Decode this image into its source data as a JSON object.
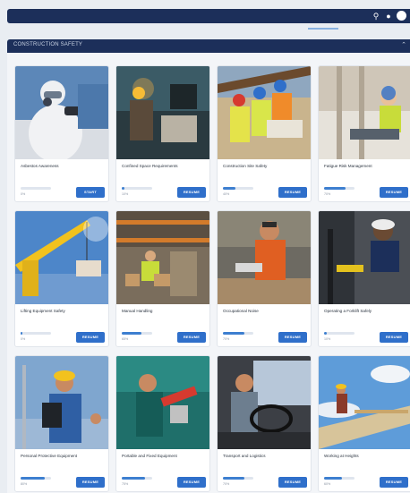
{
  "section": {
    "title": "CONSTRUCTION SAFETY"
  },
  "courses": [
    {
      "title": "Asbestos Awareness",
      "progress_text": "0%",
      "progress": 0,
      "button": "START",
      "scene": "asbestos"
    },
    {
      "title": "Confined Space Requirements",
      "progress_text": "10%",
      "progress": 10,
      "button": "RESUME",
      "scene": "confined"
    },
    {
      "title": "Construction Site Safety",
      "progress_text": "40%",
      "progress": 40,
      "button": "RESUME",
      "scene": "site"
    },
    {
      "title": "Fatigue Risk Management",
      "progress_text": "70%",
      "progress": 70,
      "button": "RESUME",
      "scene": "fatigue"
    },
    {
      "title": "Lifting Equipment Safety",
      "progress_text": "0%",
      "progress": 5,
      "button": "RESUME",
      "scene": "crane"
    },
    {
      "title": "Manual Handling",
      "progress_text": "65%",
      "progress": 65,
      "button": "RESUME",
      "scene": "warehouse"
    },
    {
      "title": "Occupational Noise",
      "progress_text": "70%",
      "progress": 70,
      "button": "RESUME",
      "scene": "noise"
    },
    {
      "title": "Operating a Forklift Safely",
      "progress_text": "10%",
      "progress": 10,
      "button": "RESUME",
      "scene": "forklift"
    },
    {
      "title": "Personal Protective Equipment",
      "progress_text": "80%",
      "progress": 80,
      "button": "RESUME",
      "scene": "ppe"
    },
    {
      "title": "Portable and Fixed Equipment",
      "progress_text": "75%",
      "progress": 75,
      "button": "RESUME",
      "scene": "tools"
    },
    {
      "title": "Transport and Logistics",
      "progress_text": "70%",
      "progress": 70,
      "button": "RESUME",
      "scene": "truck"
    },
    {
      "title": "Working at Heights",
      "progress_text": "60%",
      "progress": 60,
      "button": "RESUME",
      "scene": "heights"
    }
  ],
  "icons": {
    "search": "search-icon",
    "user": "user-icon",
    "avatar": "avatar"
  },
  "colors": {
    "nav": "#1c2f5a",
    "button": "#2f6fca",
    "progress": "#3d7fd0"
  }
}
